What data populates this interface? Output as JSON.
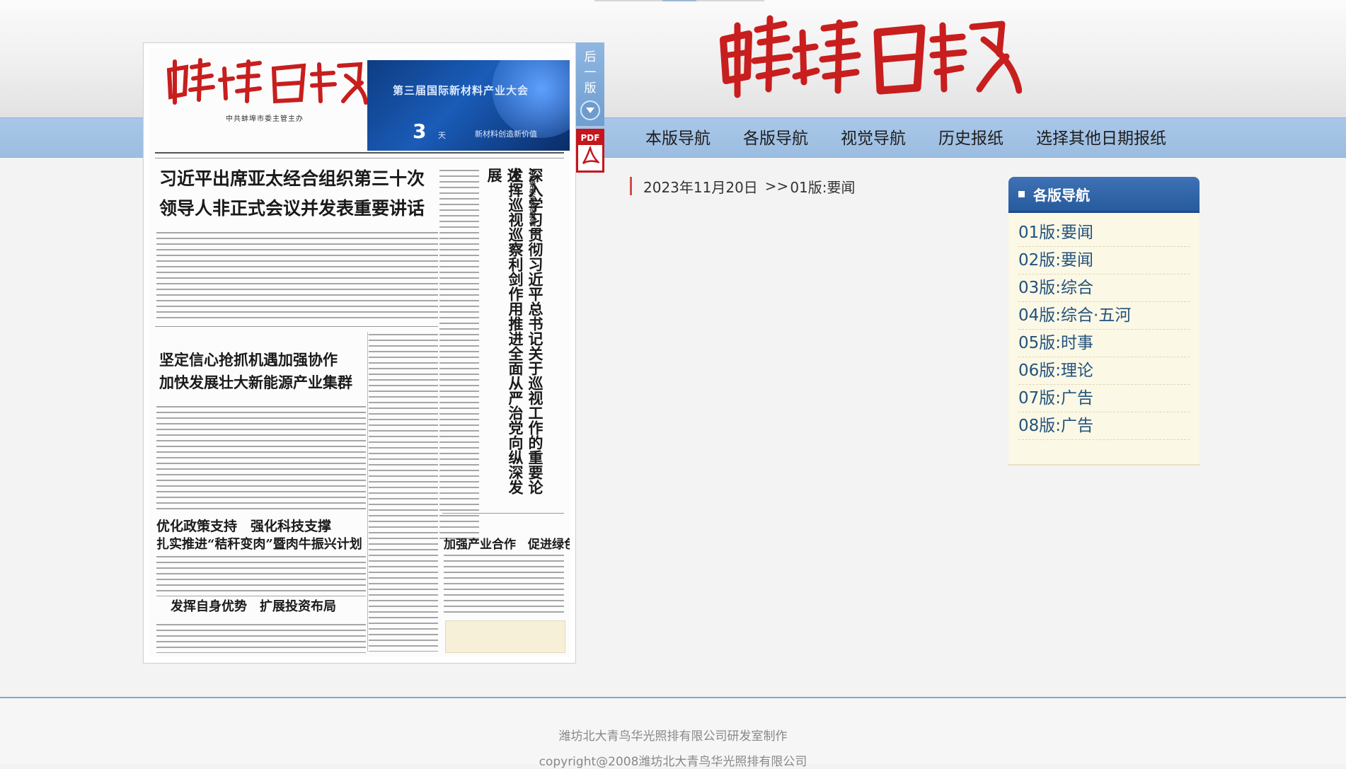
{
  "masthead": {
    "name": "蚌埠日報",
    "color": "#c81e1e"
  },
  "nav": {
    "items": [
      "本版导航",
      "各版导航",
      "视觉导航",
      "历史报纸",
      "选择其他日期报纸"
    ]
  },
  "paper_page": {
    "nameplate": "蚌埠日報",
    "nameplate_sub": "中共蚌埠市委主管主办",
    "banner_title": "第三届国际新材料产业大会",
    "banner_countdown": "3",
    "banner_unit": "天",
    "banner_tail": "新材料创造新价值",
    "headline_1a": "习近平出席亚太经合组织第三十次",
    "headline_1b": "领导人非正式会议并发表重要讲话",
    "vertical_headline": "深入学习贯彻习近平总书记关于巡视工作的重要论述",
    "vertical_headline_2": "发挥巡视巡察利剑作用推进全面从严治党向纵深发展",
    "vertical_kicker": "市委常委会会议强调",
    "headline_2a": "坚定信心抢抓机遇加强协作",
    "headline_2b": "加快发展壮大新能源产业集群",
    "headline_3a": "优化政策支持　强化科技支撑",
    "headline_3b": "扎实推进“秸秆变肉”暨肉牛振兴计划",
    "headline_4": "发挥自身优势　扩展投资布局",
    "headline_5": "加强产业合作　促进绿色发展"
  },
  "next_page_tab": {
    "label": "后一版"
  },
  "pdf_button": {
    "label": "PDF"
  },
  "breadcrumb": {
    "date": "2023年11月20日",
    "sep": ">>",
    "page": "01版:要闻"
  },
  "sidebar": {
    "title": "各版导航",
    "items": [
      "01版:要闻",
      "02版:要闻",
      "03版:综合",
      "04版:综合·五河",
      "05版:时事",
      "06版:理论",
      "07版:广告",
      "08版:广告"
    ]
  },
  "footer": {
    "line1": "潍坊北大青鸟华光照排有限公司研发室制作",
    "line2": "copyright@2008潍坊北大青鸟华光照排有限公司"
  }
}
